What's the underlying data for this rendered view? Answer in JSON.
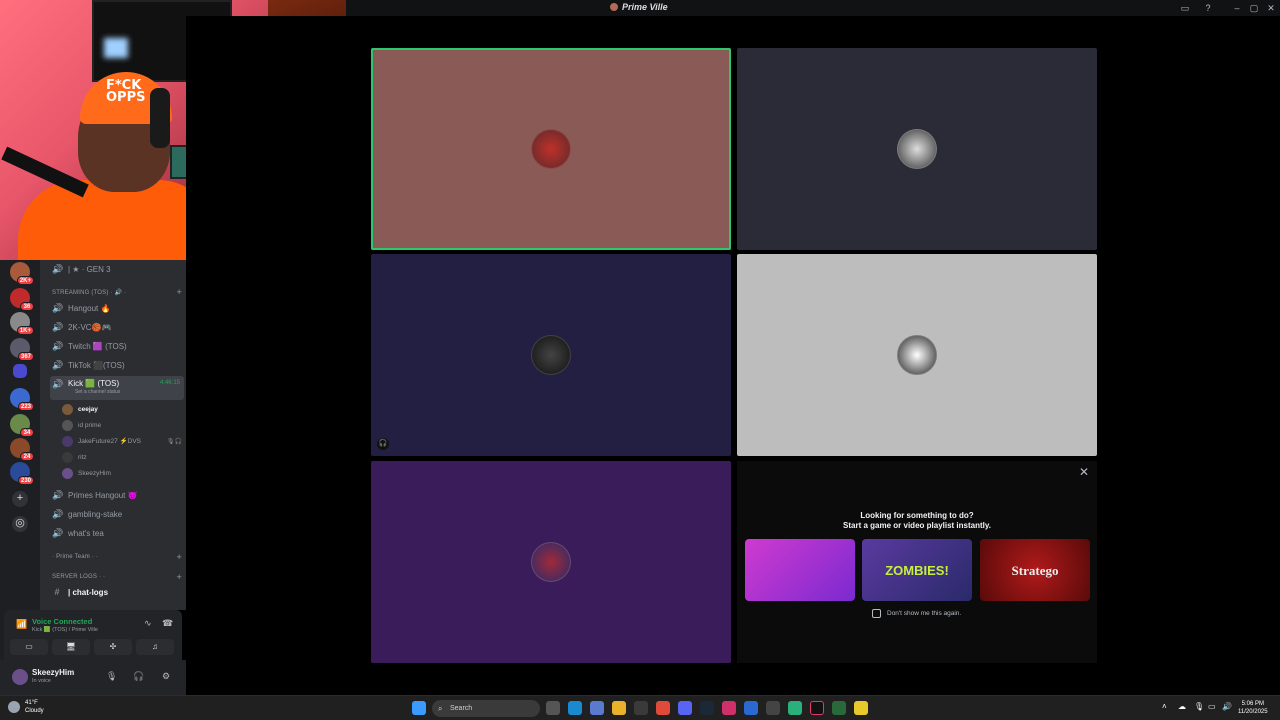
{
  "window": {
    "title": "Prime Ville"
  },
  "guilds": [
    {
      "badge": "2K+"
    },
    {
      "badge": "36"
    },
    {
      "badge": "1K+"
    },
    {
      "badge": "367"
    },
    {
      "badge": ""
    },
    {
      "badge": "223"
    },
    {
      "badge": "34"
    },
    {
      "badge": "24"
    },
    {
      "badge": "230"
    }
  ],
  "channels": {
    "gen3": "| ★ · GEN 3",
    "streaming_cat": "STREAMING (TOS) · 🔊 ·",
    "hangout": "Hangout 🔥",
    "k2vc": "2K-VC🏀🎮",
    "twitch": "Twitch 🟪 (TOS)",
    "tiktok": "TikTok ⬛(TOS)",
    "kick": "Kick 🟩 (TOS)",
    "kick_status": "Set a channel status",
    "kick_timer": "4:46:15",
    "users": [
      "ceejay",
      "id prime",
      "JakeFuture27 ⚡DVS",
      "ritz",
      "SkeezyHim"
    ],
    "primes_hangout": "Primes Hangout 😈",
    "gambling": "gambling-stake",
    "whats_tea": "what's tea",
    "prime_team_cat": "· Prime Team · ·",
    "server_logs_cat": "SERVER LOGS · ·",
    "chat_logs": "| chat-logs"
  },
  "voice": {
    "status": "Voice Connected",
    "location": "Kick 🟩 (TOS) / Prime Ville"
  },
  "me": {
    "name": "SkeezyHim",
    "status": "In voice"
  },
  "activity": {
    "line1": "Looking for something to do?",
    "line2": "Start a game or video playlist instantly.",
    "games": [
      "",
      "ZOMBIES!",
      "Stratego"
    ],
    "dont_show": "Don't show me this again."
  },
  "taskbar": {
    "temp": "41°F",
    "weather": "Cloudy",
    "search": "Search",
    "time": "5:06 PM",
    "date": "11/20/2025"
  },
  "colors": {
    "tile1": "#8a5a56",
    "tile2": "#2a2b36",
    "tile3": "#231f42",
    "tile4": "#bdbdbd",
    "tile5": "#3a1c5a",
    "speaking": "#2dc770"
  }
}
